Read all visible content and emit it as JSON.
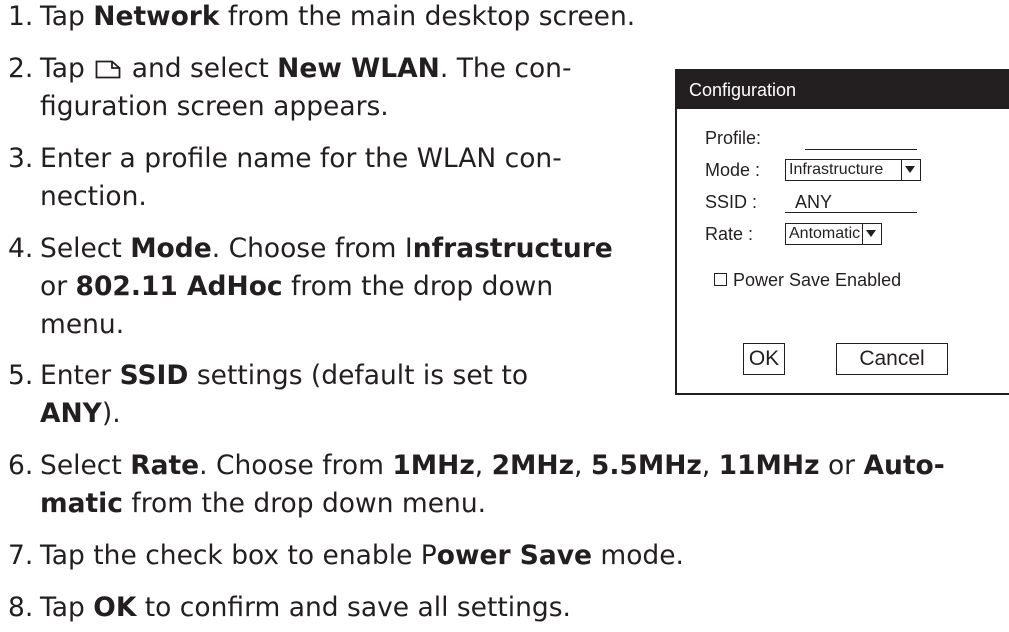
{
  "steps": [
    {
      "number": "1.",
      "line1": [
        "Tap ",
        {
          "b": "Network"
        },
        " from the main desktop screen."
      ]
    },
    {
      "number": "2.",
      "line1": [
        "Tap ",
        {
          "icon": "new"
        },
        " and select ",
        {
          "b": "New WLAN"
        },
        ". The con-"
      ],
      "line2": [
        "figuration screen appears."
      ]
    },
    {
      "number": "3.",
      "line1": [
        "Enter a profile name for the WLAN con-"
      ],
      "line2": [
        "nection."
      ]
    },
    {
      "number": "4.",
      "line1": [
        "Select ",
        {
          "b": "Mode"
        },
        ". Choose from I",
        {
          "b": "nfrastructure"
        }
      ],
      "line2": [
        "or ",
        {
          "b": "802.11 AdHoc"
        },
        " from the drop down"
      ],
      "line3": [
        "menu."
      ]
    },
    {
      "number": "5.",
      "line1": [
        "Enter ",
        {
          "b": "SSID"
        },
        " settings (default is set to"
      ],
      "line2": [
        {
          "b": "ANY"
        },
        ")."
      ]
    },
    {
      "number": "6.",
      "line1": [
        "Select ",
        {
          "b": "Rate"
        },
        ". Choose from ",
        {
          "b": "1MHz"
        },
        ", ",
        {
          "b": "2MHz"
        },
        ", ",
        {
          "b": "5.5MHz"
        },
        ", ",
        {
          "b": "11MHz"
        },
        " or ",
        {
          "b": "Auto-"
        }
      ],
      "line2": [
        {
          "b": "matic"
        },
        " from the drop down menu."
      ]
    },
    {
      "number": "7.",
      "line1": [
        "Tap the check box to enable P",
        {
          "b": "ower Save"
        },
        " mode."
      ]
    },
    {
      "number": "8.",
      "line1": [
        "Tap ",
        {
          "b": "OK"
        },
        " to confirm and save all settings."
      ]
    }
  ],
  "dialog": {
    "title": "Configuration",
    "profile_label": "Profile:",
    "profile_value": "",
    "mode_label": "Mode :",
    "mode_value": "Infrastructure",
    "ssid_label": "SSID :",
    "ssid_value": "ANY",
    "rate_label": "Rate :",
    "rate_value": "Antomatic",
    "power_save_label": "Power Save Enabled",
    "power_save_checked": false,
    "ok_label": "OK",
    "cancel_label": "Cancel"
  }
}
